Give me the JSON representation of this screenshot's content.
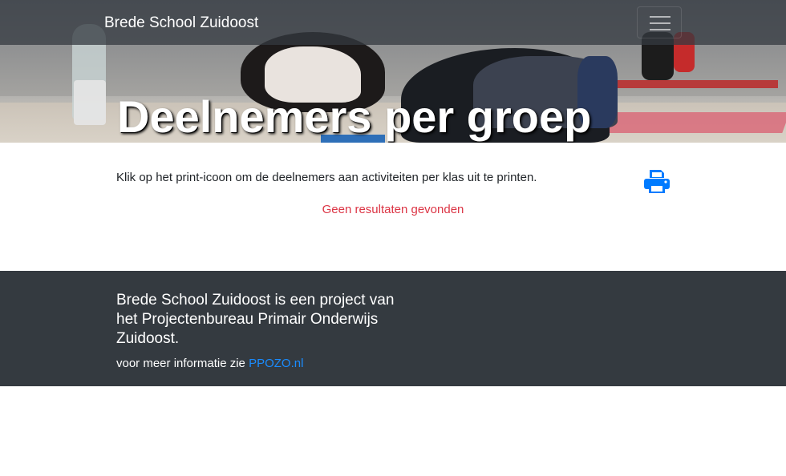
{
  "navbar": {
    "brand": "Brede School Zuidoost",
    "toggle_icon": "hamburger-menu-icon"
  },
  "hero": {
    "title": "Deelnemers per groep"
  },
  "main": {
    "intro": "Klik op het print-icoon om de deelnemers aan activiteiten per klas uit te printen.",
    "print_icon": "printer-icon",
    "no_results": "Geen resultaten gevonden"
  },
  "footer": {
    "title": "Brede School Zuidoost is een project van het Projectenbureau Primair Onderwijs Zuidoost.",
    "info_prefix": "voor meer informatie zie",
    "link_text": "PPOZO.nl"
  },
  "colors": {
    "navbar_bg": "#343a40",
    "link": "#007bff",
    "danger": "#dc3545",
    "footer_bg": "#343a40"
  }
}
